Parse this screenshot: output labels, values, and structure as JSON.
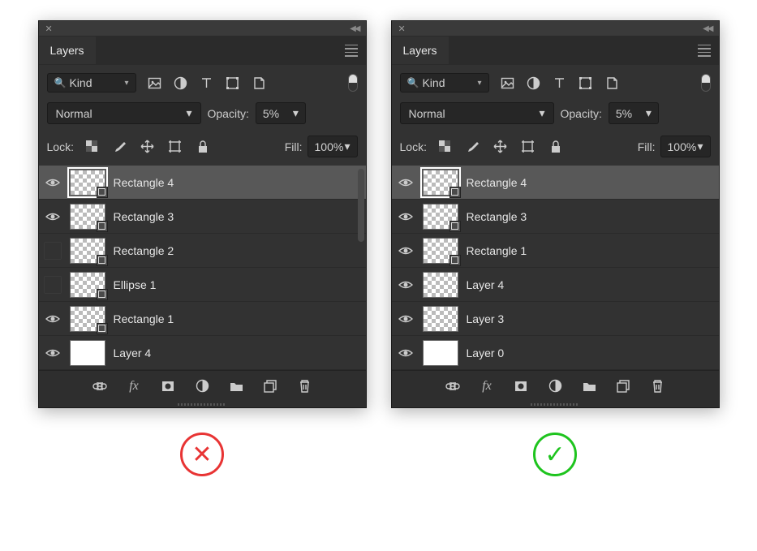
{
  "panel_title": "Layers",
  "filter": {
    "kind_label": "Kind"
  },
  "blend": {
    "mode": "Normal",
    "opacity_label": "Opacity:",
    "opacity_value": "5%"
  },
  "lock": {
    "label": "Lock:",
    "fill_label": "Fill:",
    "fill_value": "100%"
  },
  "left_panel": {
    "layers": [
      {
        "name": "Rectangle 4",
        "visible": true,
        "selected": true,
        "shape": true,
        "checker": true
      },
      {
        "name": "Rectangle 3",
        "visible": true,
        "selected": false,
        "shape": true,
        "checker": true
      },
      {
        "name": "Rectangle 2",
        "visible": false,
        "selected": false,
        "shape": true,
        "checker": true
      },
      {
        "name": "Ellipse 1",
        "visible": false,
        "selected": false,
        "shape": true,
        "checker": true
      },
      {
        "name": "Rectangle 1",
        "visible": true,
        "selected": false,
        "shape": true,
        "checker": true
      },
      {
        "name": "Layer 4",
        "visible": true,
        "selected": false,
        "shape": false,
        "checker": false
      }
    ],
    "show_scrollbar": true,
    "verdict": "bad"
  },
  "right_panel": {
    "layers": [
      {
        "name": "Rectangle 4",
        "visible": true,
        "selected": true,
        "shape": true,
        "checker": true
      },
      {
        "name": "Rectangle 3",
        "visible": true,
        "selected": false,
        "shape": true,
        "checker": true
      },
      {
        "name": "Rectangle 1",
        "visible": true,
        "selected": false,
        "shape": true,
        "checker": true
      },
      {
        "name": "Layer 4",
        "visible": true,
        "selected": false,
        "shape": false,
        "checker": true
      },
      {
        "name": "Layer 3",
        "visible": true,
        "selected": false,
        "shape": false,
        "checker": true
      },
      {
        "name": "Layer 0",
        "visible": true,
        "selected": false,
        "shape": false,
        "checker": false
      }
    ],
    "show_scrollbar": false,
    "verdict": "good"
  }
}
